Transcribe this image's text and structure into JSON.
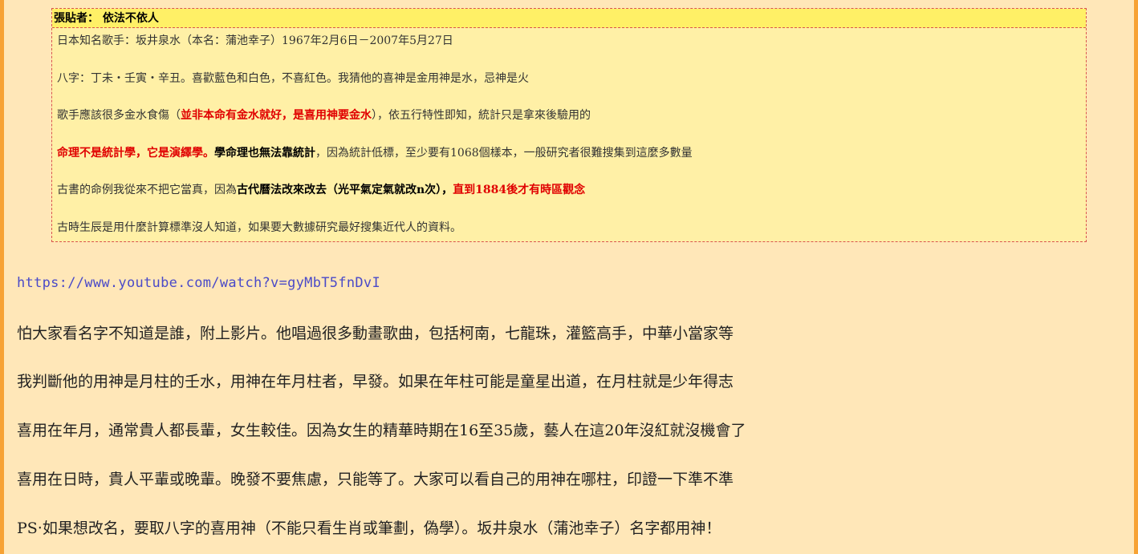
{
  "quote": {
    "header": "張貼者： 依法不依人",
    "lines": {
      "l1": "日本知名歌手：坂井泉水（本名：蒲池幸子）1967年2月6日－2007年5月27日",
      "l2": "八字：丁未‧壬寅‧辛丑。喜歡藍色和白色，不喜紅色。我猜他的喜神是金用神是水，忌神是火",
      "l3_a": "歌手應該很多金水食傷（",
      "l3_b": "並非本命有金水就好，是喜用神要金水",
      "l3_c": "），依五行特性即知，統計只是拿來後驗用的",
      "l4_a": "命理不是統計學，它是演繹學。",
      "l4_b": "學命理也無法靠統計",
      "l4_c": "，因為統計低標，至少要有1068個樣本，一般研究者很難搜集到這麼多數量",
      "l5_a": "古書的命例我從來不把它當真，因為",
      "l5_b": "古代曆法改來改去（光平氣定氣就改n次），",
      "l5_c": "直到1884後才有時區觀念",
      "l6": "古時生辰是用什麼計算標準沒人知道，如果要大數據研究最好搜集近代人的資料。"
    }
  },
  "link": {
    "url": "https://www.youtube.com/watch?v=gyMbT5fnDvI"
  },
  "paragraphs": {
    "p1": "怕大家看名字不知道是誰，附上影片。他唱過很多動畫歌曲，包括柯南，七龍珠，灌籃高手，中華小當家等",
    "p2": "我判斷他的用神是月柱的壬水，用神在年月柱者，早發。如果在年柱可能是童星出道，在月柱就是少年得志",
    "p3": "喜用在年月，通常貴人都長輩，女生較佳。因為女生的精華時期在16至35歲，藝人在這20年沒紅就沒機會了",
    "p4": "喜用在日時，貴人平輩或晚輩。晚發不要焦慮，只能等了。大家可以看自己的用神在哪柱，印證一下準不準",
    "p5": "PS‧如果想改名，要取八字的喜用神（不能只看生肖或筆劃，偽學）。坂井泉水（蒲池幸子）名字都用神！"
  },
  "colors": {
    "page_bg": "#ffe7b8",
    "border": "#f7a234",
    "quote_bg": "#fff0a6",
    "quote_header_bg": "#fff066",
    "emphasis_red": "#e00000",
    "link": "#4a4ac8"
  }
}
